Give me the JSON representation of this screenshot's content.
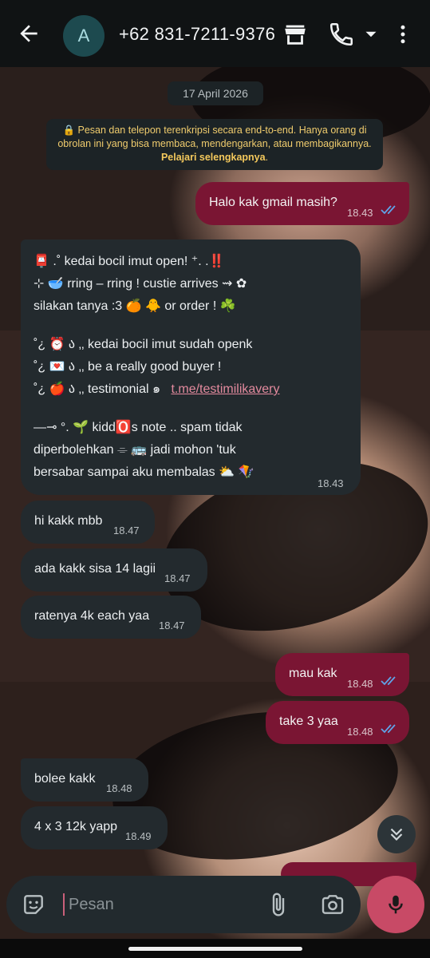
{
  "header": {
    "avatar_letter": "A",
    "contact_name": "+62 831-7211-9376",
    "icons": [
      "back-arrow-icon",
      "store-icon",
      "phone-icon",
      "dropdown-arrow-icon",
      "more-vert-icon"
    ]
  },
  "chat": {
    "date": "17 April 2026",
    "encryption_notice": "🔒 Pesan dan telepon terenkripsi secara end-to-end. Hanya orang di obrolan ini yang bisa membaca, mendengarkan, atau membagikannya.",
    "encryption_link": "Pelajari selengkapnya",
    "messages": [
      {
        "dir": "out",
        "text": "Halo kak gmail masih?",
        "time": "18.43",
        "read": true
      },
      {
        "dir": "in",
        "lines": [
          "📮 .˚ kedai bocil imut open!  ⁺. .‼️",
          "⊹ 🥣 rring – rring ! custie arrives ⇝ ✿",
          "silakan tanya :3 🍊 🐥 or order ! ☘️",
          "",
          "˚¿ ⏰ ა ‚‚ kedai bocil imut sudah openk",
          "˚¿ 💌 ა ‚‚ be a really good buyer !",
          "˚¿ 🍎 ა ‚‚ testimonial ๑",
          "",
          "⎯⎯⊸ °. 🌱 kidd🅾️s note .. spam tidak",
          "diperbolehkan ⌯ 🚌 jadi mohon 'tuk",
          "bersabar sampai aku membalas ⛅ 🪁"
        ],
        "link": "t.me/testimilikavery",
        "time": "18.43"
      },
      {
        "dir": "in",
        "text": "hi kakk mbb",
        "time": "18.47"
      },
      {
        "dir": "in",
        "text": "ada kakk sisa 14 lagii",
        "time": "18.47"
      },
      {
        "dir": "in",
        "text": "ratenya 4k each yaa",
        "time": "18.47"
      },
      {
        "dir": "out",
        "text": "mau kak",
        "time": "18.48",
        "read": true
      },
      {
        "dir": "out",
        "text": "take 3 yaa",
        "time": "18.48",
        "read": true
      },
      {
        "dir": "in",
        "text": "bolee kakk",
        "time": "18.48"
      },
      {
        "dir": "in",
        "text": "4 x 3 12k yapp",
        "time": "18.49"
      }
    ]
  },
  "composer": {
    "placeholder": "Pesan",
    "icons": [
      "emoji-icon",
      "attach-icon",
      "camera-icon",
      "mic-icon"
    ]
  },
  "colors": {
    "outgoing_bubble": "#7a1533",
    "incoming_bubble": "#232a2e",
    "read_ticks": "#5fa3e8",
    "mic_button": "#c84a66",
    "notice_text": "#f0cc6d"
  }
}
